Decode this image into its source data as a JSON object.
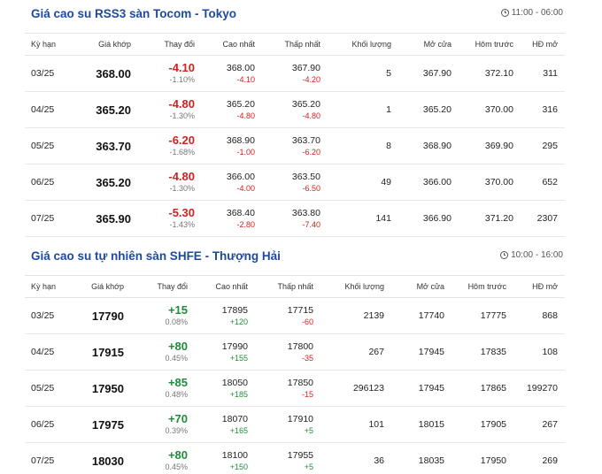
{
  "tocom": {
    "title": "Giá cao su RSS3 sàn Tocom - Tokyo",
    "time": "11:00 - 06:00",
    "headers": [
      "Kỳ hạn",
      "Giá khớp",
      "Thay đổi",
      "Cao nhất",
      "Thấp nhất",
      "Khối lượng",
      "Mở cửa",
      "Hôm trước",
      "HĐ mở"
    ],
    "rows": [
      {
        "term": "03/25",
        "price": "368.00",
        "chg": "-4.10",
        "pct": "-1.10%",
        "high": "368.00",
        "high_chg": "-4.10",
        "low": "367.90",
        "low_chg": "-4.20",
        "volume": "5",
        "open": "367.90",
        "prev": "372.10",
        "oi": "311"
      },
      {
        "term": "04/25",
        "price": "365.20",
        "chg": "-4.80",
        "pct": "-1.30%",
        "high": "365.20",
        "high_chg": "-4.80",
        "low": "365.20",
        "low_chg": "-4.80",
        "volume": "1",
        "open": "365.20",
        "prev": "370.00",
        "oi": "316"
      },
      {
        "term": "05/25",
        "price": "363.70",
        "chg": "-6.20",
        "pct": "-1.68%",
        "high": "368.90",
        "high_chg": "-1.00",
        "low": "363.70",
        "low_chg": "-6.20",
        "volume": "8",
        "open": "368.90",
        "prev": "369.90",
        "oi": "295"
      },
      {
        "term": "06/25",
        "price": "365.20",
        "chg": "-4.80",
        "pct": "-1.30%",
        "high": "366.00",
        "high_chg": "-4.00",
        "low": "363.50",
        "low_chg": "-6.50",
        "volume": "49",
        "open": "366.00",
        "prev": "370.00",
        "oi": "652"
      },
      {
        "term": "07/25",
        "price": "365.90",
        "chg": "-5.30",
        "pct": "-1.43%",
        "high": "368.40",
        "high_chg": "-2.80",
        "low": "363.80",
        "low_chg": "-7.40",
        "volume": "141",
        "open": "366.90",
        "prev": "371.20",
        "oi": "2307"
      }
    ]
  },
  "shfe": {
    "title": "Giá cao su tự nhiên sàn SHFE - Thượng Hải",
    "time": "10:00 - 16:00",
    "headers": [
      "Kỳ hạn",
      "Giá khớp",
      "Thay đổi",
      "Cao nhất",
      "Thấp nhất",
      "Khối lượng",
      "Mở cửa",
      "Hôm trước",
      "HĐ mở"
    ],
    "rows": [
      {
        "term": "03/25",
        "price": "17790",
        "chg": "+15",
        "pct": "0.08%",
        "high": "17895",
        "high_chg": "+120",
        "low": "17715",
        "low_chg": "-60",
        "volume": "2139",
        "open": "17740",
        "prev": "17775",
        "oi": "868"
      },
      {
        "term": "04/25",
        "price": "17915",
        "chg": "+80",
        "pct": "0.45%",
        "high": "17990",
        "high_chg": "+155",
        "low": "17800",
        "low_chg": "-35",
        "volume": "267",
        "open": "17945",
        "prev": "17835",
        "oi": "108"
      },
      {
        "term": "05/25",
        "price": "17950",
        "chg": "+85",
        "pct": "0.48%",
        "high": "18050",
        "high_chg": "+185",
        "low": "17850",
        "low_chg": "-15",
        "volume": "296123",
        "open": "17945",
        "prev": "17865",
        "oi": "199270"
      },
      {
        "term": "06/25",
        "price": "17975",
        "chg": "+70",
        "pct": "0.39%",
        "high": "18070",
        "high_chg": "+165",
        "low": "17910",
        "low_chg": "+5",
        "volume": "101",
        "open": "18015",
        "prev": "17905",
        "oi": "267"
      },
      {
        "term": "07/25",
        "price": "18030",
        "chg": "+80",
        "pct": "0.45%",
        "high": "18100",
        "high_chg": "+150",
        "low": "17955",
        "low_chg": "+5",
        "volume": "36",
        "open": "18035",
        "prev": "17950",
        "oi": "269"
      }
    ]
  },
  "colors": {
    "title": "#1d4aa0",
    "negative": "#d0221f",
    "positive": "#1e8c3a"
  }
}
